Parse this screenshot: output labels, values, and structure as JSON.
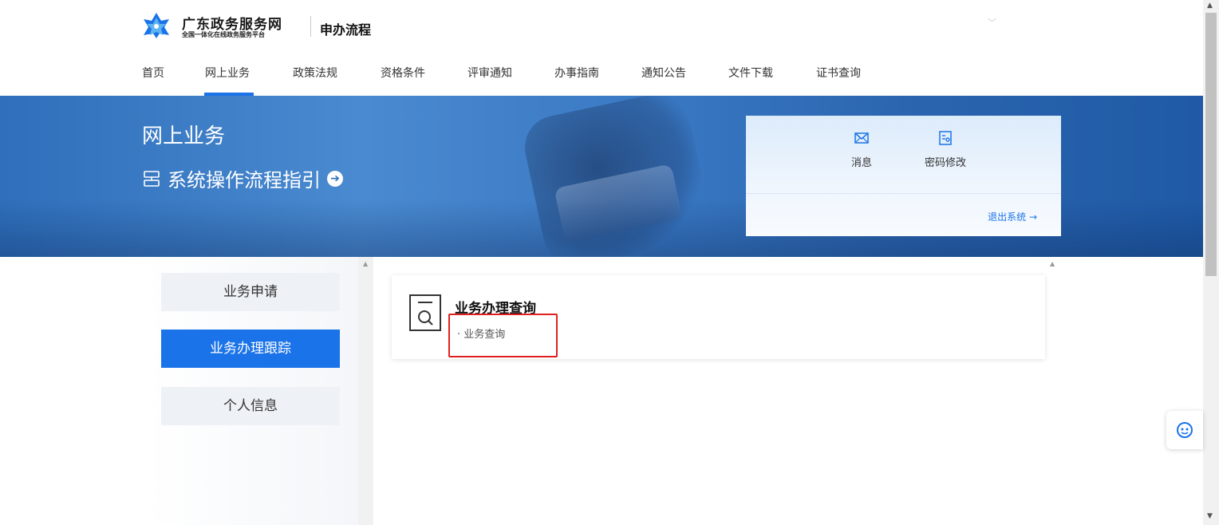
{
  "header": {
    "logo_title": "广东政务服务网",
    "logo_subtitle": "全国一体化在线政务服务平台",
    "app_title": "申办流程"
  },
  "nav": {
    "items": [
      {
        "label": "首页"
      },
      {
        "label": "网上业务"
      },
      {
        "label": "政策法规"
      },
      {
        "label": "资格条件"
      },
      {
        "label": "评审通知"
      },
      {
        "label": "办事指南"
      },
      {
        "label": "通知公告"
      },
      {
        "label": "文件下载"
      },
      {
        "label": "证书查询"
      }
    ],
    "active": "网上业务"
  },
  "banner": {
    "title": "网上业务",
    "guide_label": "系统操作流程指引"
  },
  "user_card": {
    "message_label": "消息",
    "password_label": "密码修改",
    "logout_label": "退出系统 →"
  },
  "sidebar": {
    "items": [
      {
        "label": "业务申请"
      },
      {
        "label": "业务办理跟踪"
      },
      {
        "label": "个人信息"
      }
    ],
    "active": "业务办理跟踪"
  },
  "main": {
    "card_title": "业务办理查询",
    "link_label": "· 业务查询"
  },
  "colors": {
    "accent": "#1a73e8",
    "highlight": "#e02020",
    "banner": "#2f6fbb"
  }
}
